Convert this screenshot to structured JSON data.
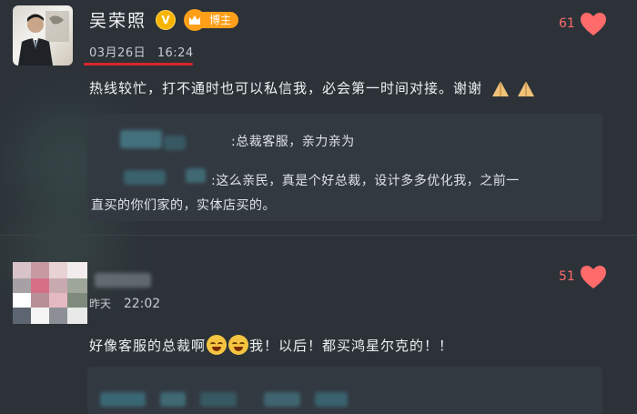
{
  "post": {
    "author": "吴荣照",
    "verified_mark": "V",
    "badge_label": "博主",
    "date_prefix": "03月26日",
    "time": "16:24",
    "likes": "61",
    "text": "热线较忙，打不通时也可以私信我，必会第一时间对接。谢谢",
    "emoji_icon": "praying-hands-icon",
    "reply": {
      "line1": ":总裁客服，亲力亲为",
      "line2": ":这么亲民，真是个好总裁，设计多多优化我，之前一",
      "line3": "直买的你们家的，实体店买的。"
    }
  },
  "comment": {
    "time_label": "昨天",
    "time": "22:02",
    "likes": "51",
    "text_before": "好像客服的总裁啊",
    "text_after": "我！以后！都买鸿星尔克的！！",
    "emoji_icon": "laughing-tears-icon"
  },
  "colors": {
    "background": "#2c3238",
    "accent_red": "#ff6b6b",
    "underline_red": "#d9252b",
    "badge_orange": "#ff9f1a",
    "verify_gold": "#f6b400"
  }
}
